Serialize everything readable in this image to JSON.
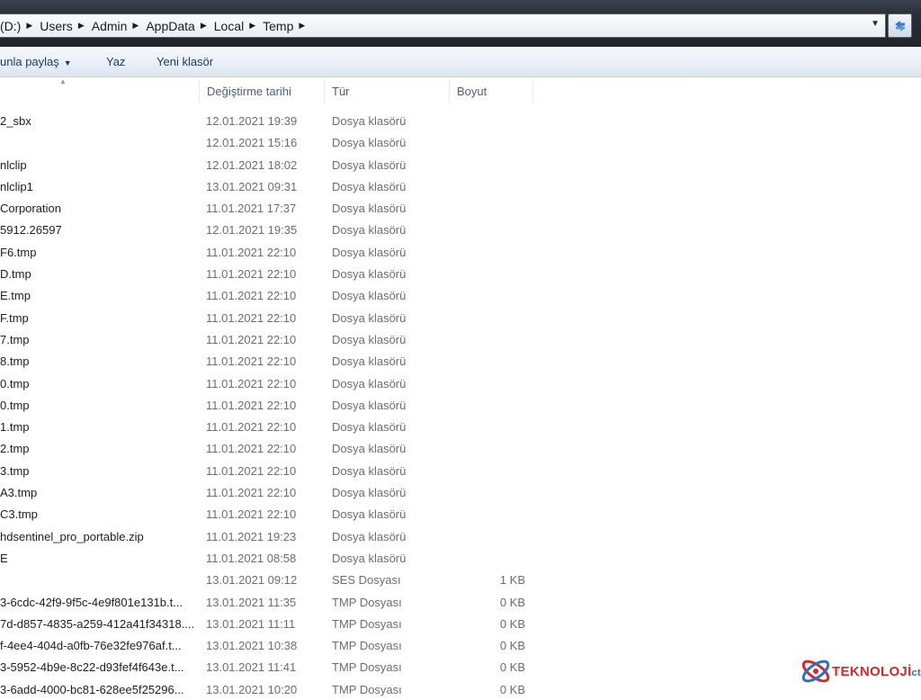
{
  "address": {
    "crumbs": [
      "(D:)",
      "Users",
      "Admin",
      "AppData",
      "Local",
      "Temp"
    ]
  },
  "toolbar": {
    "share_label": "unla paylaş",
    "write_label": "Yaz",
    "new_folder_label": "Yeni klasör"
  },
  "columns": {
    "date": "Değiştirme tarihi",
    "type": "Tür",
    "size": "Boyut"
  },
  "files": [
    {
      "name": "2_sbx",
      "date": "12.01.2021 19:39",
      "type": "Dosya klasörü",
      "size": ""
    },
    {
      "name": "",
      "date": "12.01.2021 15:16",
      "type": "Dosya klasörü",
      "size": ""
    },
    {
      "name": "nlclip",
      "date": "12.01.2021 18:02",
      "type": "Dosya klasörü",
      "size": ""
    },
    {
      "name": "nlclip1",
      "date": "13.01.2021 09:31",
      "type": "Dosya klasörü",
      "size": ""
    },
    {
      "name": "Corporation",
      "date": "11.01.2021 17:37",
      "type": "Dosya klasörü",
      "size": ""
    },
    {
      "name": "5912.26597",
      "date": "12.01.2021 19:35",
      "type": "Dosya klasörü",
      "size": ""
    },
    {
      "name": "F6.tmp",
      "date": "11.01.2021 22:10",
      "type": "Dosya klasörü",
      "size": ""
    },
    {
      "name": "D.tmp",
      "date": "11.01.2021 22:10",
      "type": "Dosya klasörü",
      "size": ""
    },
    {
      "name": "E.tmp",
      "date": "11.01.2021 22:10",
      "type": "Dosya klasörü",
      "size": ""
    },
    {
      "name": "F.tmp",
      "date": "11.01.2021 22:10",
      "type": "Dosya klasörü",
      "size": ""
    },
    {
      "name": "7.tmp",
      "date": "11.01.2021 22:10",
      "type": "Dosya klasörü",
      "size": ""
    },
    {
      "name": "8.tmp",
      "date": "11.01.2021 22:10",
      "type": "Dosya klasörü",
      "size": ""
    },
    {
      "name": "0.tmp",
      "date": "11.01.2021 22:10",
      "type": "Dosya klasörü",
      "size": ""
    },
    {
      "name": "0.tmp",
      "date": "11.01.2021 22:10",
      "type": "Dosya klasörü",
      "size": ""
    },
    {
      "name": "1.tmp",
      "date": "11.01.2021 22:10",
      "type": "Dosya klasörü",
      "size": ""
    },
    {
      "name": "2.tmp",
      "date": "11.01.2021 22:10",
      "type": "Dosya klasörü",
      "size": ""
    },
    {
      "name": "3.tmp",
      "date": "11.01.2021 22:10",
      "type": "Dosya klasörü",
      "size": ""
    },
    {
      "name": "A3.tmp",
      "date": "11.01.2021 22:10",
      "type": "Dosya klasörü",
      "size": ""
    },
    {
      "name": "C3.tmp",
      "date": "11.01.2021 22:10",
      "type": "Dosya klasörü",
      "size": ""
    },
    {
      "name": "hdsentinel_pro_portable.zip",
      "date": "11.01.2021 19:23",
      "type": "Dosya klasörü",
      "size": ""
    },
    {
      "name": "E",
      "date": "11.01.2021 08:58",
      "type": "Dosya klasörü",
      "size": ""
    },
    {
      "name": "",
      "date": "13.01.2021 09:12",
      "type": "SES Dosyası",
      "size": "1 KB"
    },
    {
      "name": "3-6cdc-42f9-9f5c-4e9f801e131b.t...",
      "date": "13.01.2021 11:35",
      "type": "TMP Dosyası",
      "size": "0 KB"
    },
    {
      "name": "7d-d857-4835-a259-412a41f34318....",
      "date": "13.01.2021 11:11",
      "type": "TMP Dosyası",
      "size": "0 KB"
    },
    {
      "name": "f-4ee4-404d-a0fb-76e32fe976af.t...",
      "date": "13.01.2021 10:38",
      "type": "TMP Dosyası",
      "size": "0 KB"
    },
    {
      "name": "3-5952-4b9e-8c22-d93fef4f643e.t...",
      "date": "13.01.2021 11:41",
      "type": "TMP Dosyası",
      "size": "0 KB"
    },
    {
      "name": "3-6add-4000-bc81-628ee5f25296...",
      "date": "13.01.2021 10:20",
      "type": "TMP Dosyası",
      "size": "0 KB"
    }
  ],
  "logo": {
    "text": "TEKNOLOJİ",
    "suffix": "ct"
  }
}
